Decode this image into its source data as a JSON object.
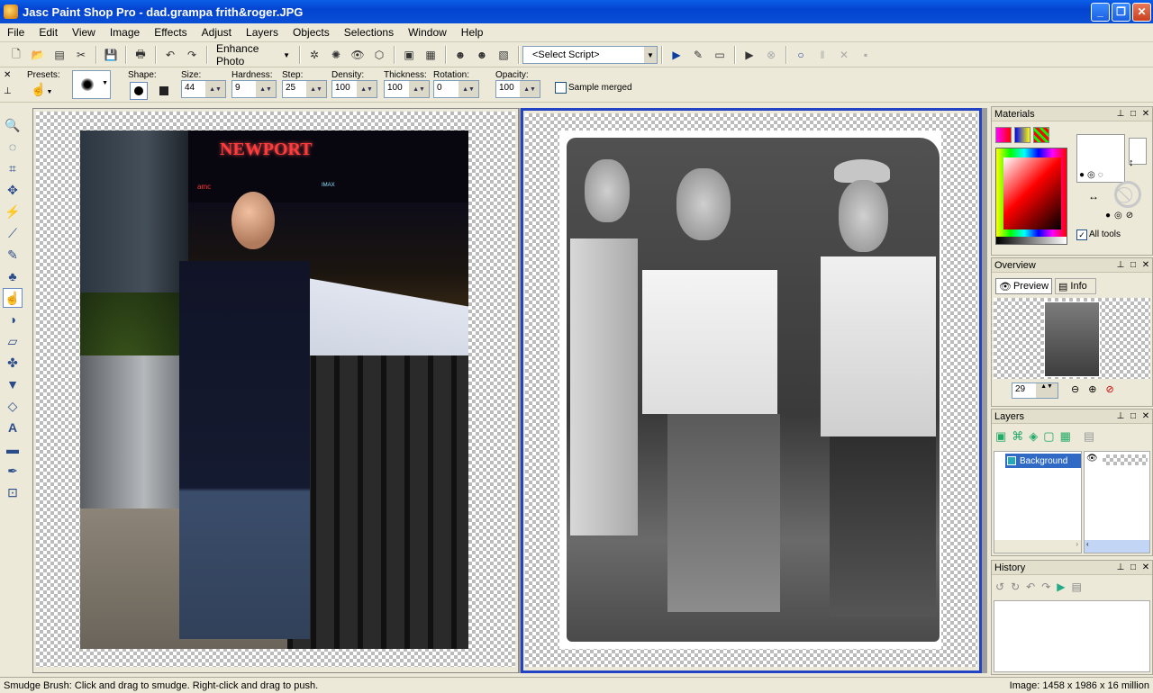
{
  "window": {
    "title": "Jasc Paint Shop Pro - dad.grampa frith&roger.JPG"
  },
  "menu": [
    "File",
    "Edit",
    "View",
    "Image",
    "Effects",
    "Adjust",
    "Layers",
    "Objects",
    "Selections",
    "Window",
    "Help"
  ],
  "toolbar": {
    "enhance_photo": "Enhance Photo",
    "script_select": "<Select Script>"
  },
  "tool_options": {
    "presets_label": "Presets:",
    "shape_label": "Shape:",
    "size_label": "Size:",
    "size_value": "44",
    "hardness_label": "Hardness:",
    "hardness_value": "9",
    "step_label": "Step:",
    "step_value": "25",
    "density_label": "Density:",
    "density_value": "100",
    "thickness_label": "Thickness:",
    "thickness_value": "100",
    "rotation_label": "Rotation:",
    "rotation_value": "0",
    "opacity_label": "Opacity:",
    "opacity_value": "100",
    "sample_merged_label": "Sample merged"
  },
  "images": {
    "sign_text": "NEWPORT",
    "sign_small1": "amc",
    "sign_small2": "IMAX"
  },
  "materials": {
    "title": "Materials",
    "all_tools_label": "All tools"
  },
  "overview": {
    "title": "Overview",
    "tab_preview": "Preview",
    "tab_info": "Info",
    "zoom_value": "29"
  },
  "layers": {
    "title": "Layers",
    "layer_name": "Background"
  },
  "history": {
    "title": "History"
  },
  "status": {
    "hint": "Smudge Brush: Click and drag to smudge. Right-click and drag to push.",
    "image_info": "Image:  1458 x 1986 x 16 million"
  }
}
